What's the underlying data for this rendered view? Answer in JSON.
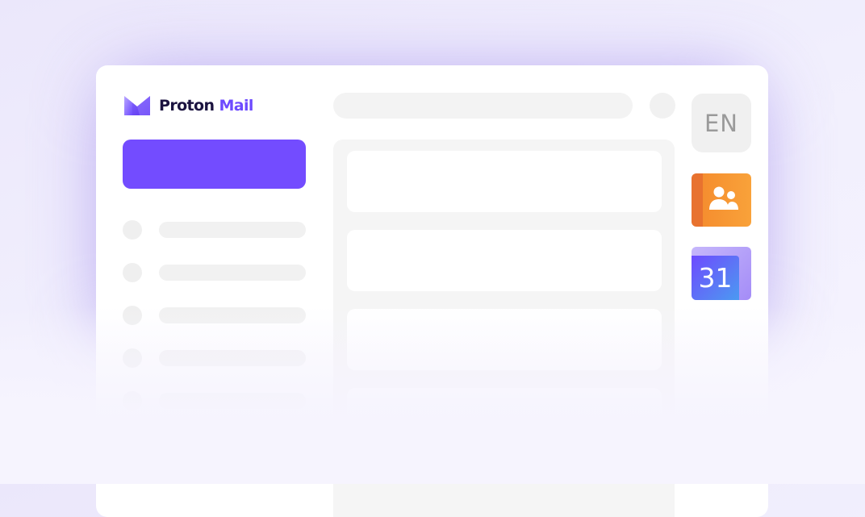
{
  "app": {
    "brand_word1": "Proton",
    "brand_word2": "Mail",
    "logo_icon": "proton-mail-logo-icon"
  },
  "sidebar": {
    "compose_label": "",
    "nav_items": [
      {
        "label": ""
      },
      {
        "label": ""
      },
      {
        "label": ""
      },
      {
        "label": ""
      },
      {
        "label": ""
      }
    ]
  },
  "header": {
    "search_placeholder": ""
  },
  "message_list": {
    "items": [
      {
        "subject": ""
      },
      {
        "subject": ""
      },
      {
        "subject": ""
      },
      {
        "subject": ""
      }
    ]
  },
  "side_apps": {
    "language": "EN",
    "contacts_icon": "contacts-icon",
    "calendar_day": "31",
    "calendar_icon": "calendar-icon"
  },
  "colors": {
    "brand_purple": "#6d4aff",
    "compose_button": "#734cff",
    "brand_dark": "#1b1340",
    "contacts_orange": "#f58e2f",
    "calendar_blue": "#4a9af2",
    "background": "#f1effd"
  }
}
